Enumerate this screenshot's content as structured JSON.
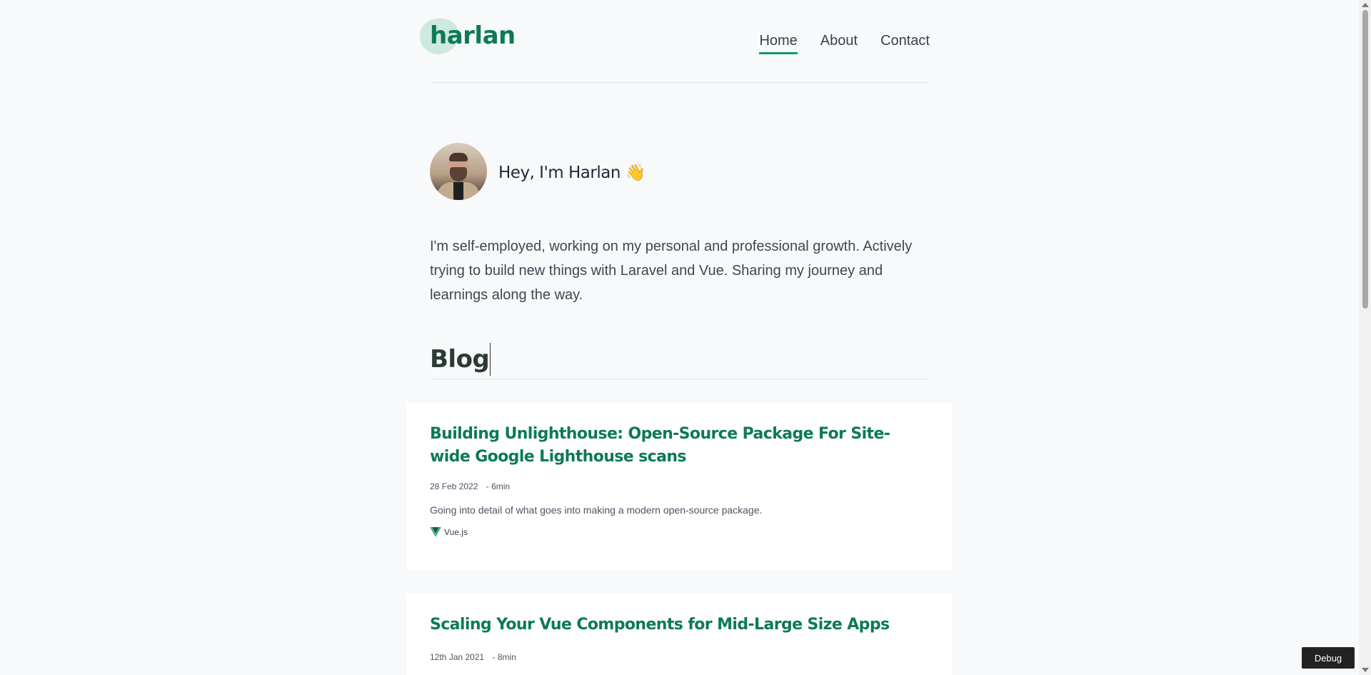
{
  "header": {
    "logo": "harlan",
    "nav": [
      {
        "label": "Home",
        "active": true
      },
      {
        "label": "About",
        "active": false
      },
      {
        "label": "Contact",
        "active": false
      }
    ]
  },
  "intro": {
    "avatar_icon": "avatar-photo",
    "greeting": "Hey, I'm Harlan 👋",
    "bio": "I'm self-employed, working on my personal and professional growth. Actively trying to build new things with Laravel and Vue. Sharing my journey and learnings along the way."
  },
  "blog": {
    "heading": "Blog",
    "posts": [
      {
        "title": "Building Unlighthouse: Open-Source Package For Site-wide Google Lighthouse scans",
        "date": "28 Feb 2022",
        "read_time": "- 6min",
        "excerpt": "Going into detail of what goes into making a modern open-source package.",
        "tag": "Vue.js",
        "tag_icon": "vue-icon"
      },
      {
        "title": "Scaling Your Vue Components for Mid-Large Size Apps",
        "date": "12th Jan 2021",
        "read_time": "- 8min"
      }
    ]
  },
  "debug_button": "Debug",
  "colors": {
    "accent": "#0d7a55",
    "underline": "#0d9a68",
    "background": "#f8f9fb"
  }
}
